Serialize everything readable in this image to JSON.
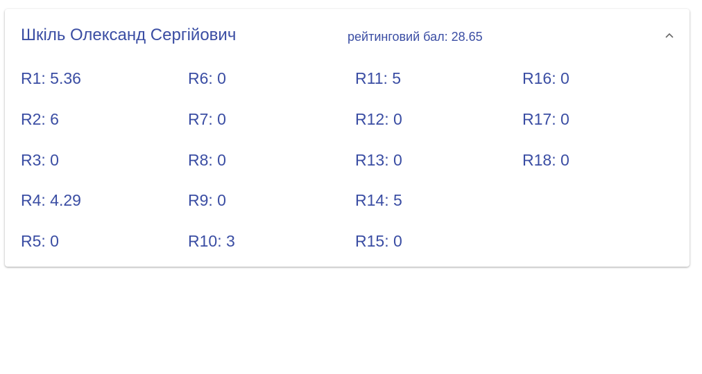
{
  "card": {
    "name": "Шкіль Олександ Сергійович",
    "rating": "рейтинговий бал: 28.65",
    "toggle_icon": "chevron-up-icon"
  },
  "colors": {
    "accent": "#3a4da3"
  },
  "scores": [
    [
      "R1: 5.36",
      "R2: 6",
      "R3: 0",
      "R4: 4.29",
      "R5: 0"
    ],
    [
      "R6: 0",
      "R7: 0",
      "R8: 0",
      "R9: 0",
      "R10: 3"
    ],
    [
      "R11: 5",
      "R12: 0",
      "R13: 0",
      "R14: 5",
      "R15: 0"
    ],
    [
      "R16: 0",
      "R17: 0",
      "R18: 0"
    ]
  ]
}
